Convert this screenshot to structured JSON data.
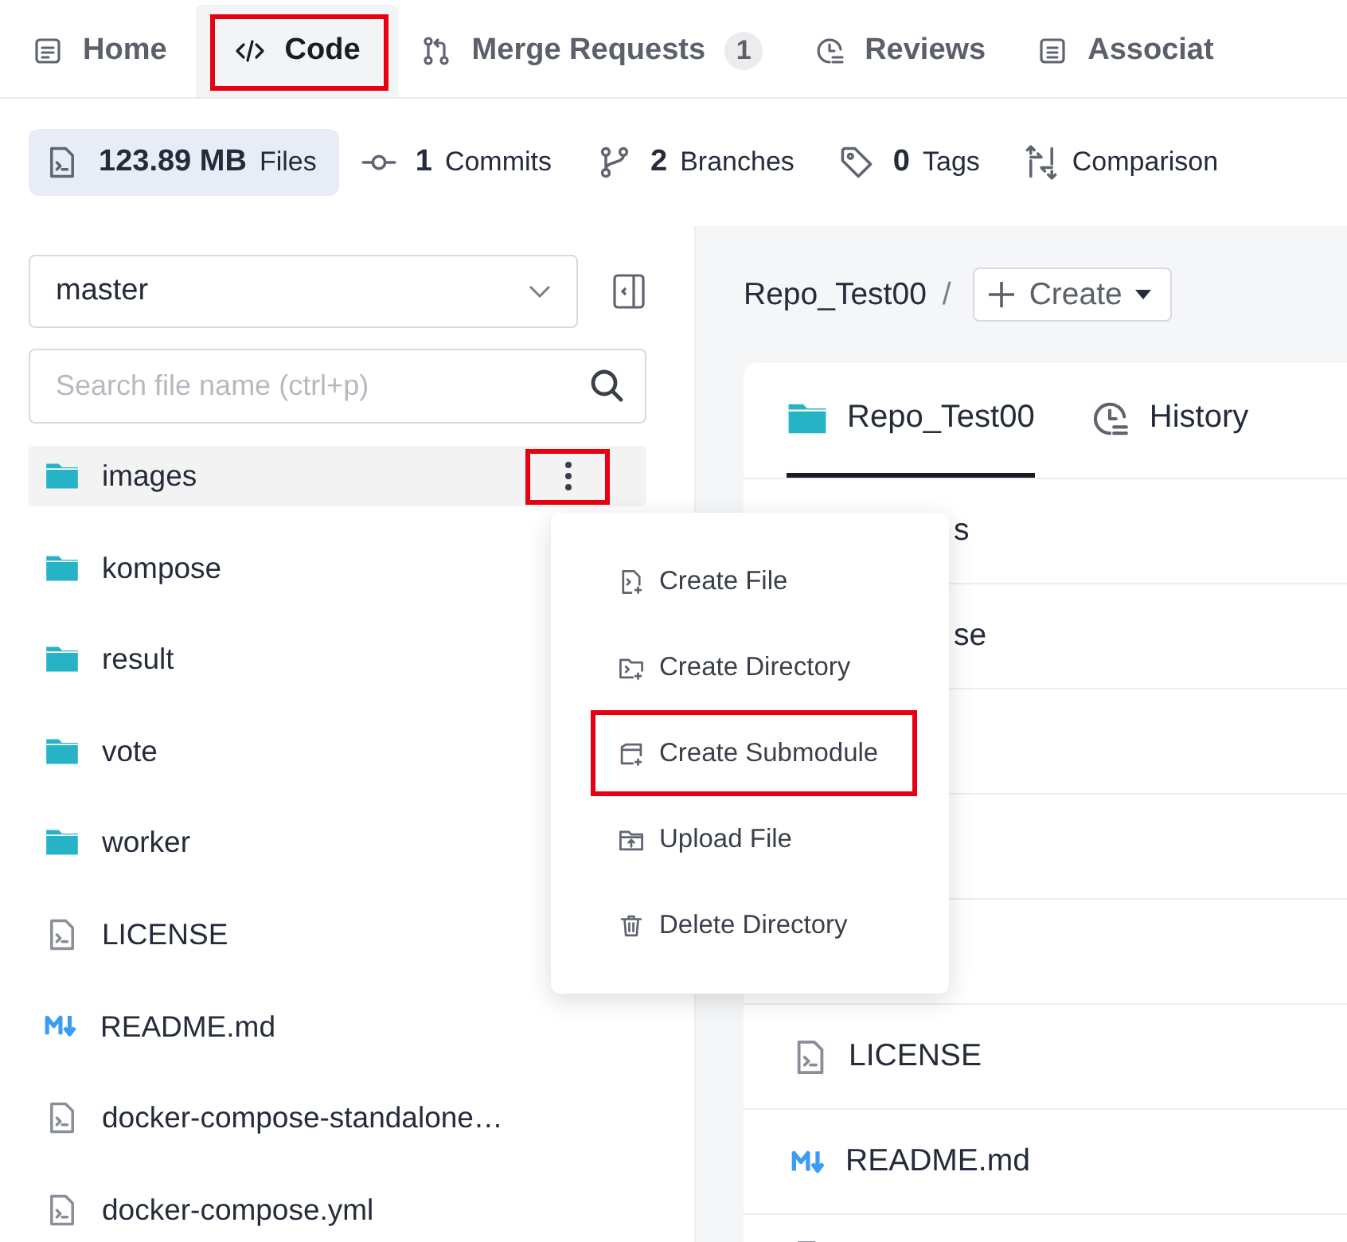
{
  "tabs": [
    {
      "label": "Home",
      "selected": false,
      "highlighted": false
    },
    {
      "label": "Code",
      "selected": true,
      "highlighted": true
    },
    {
      "label": "Merge Requests",
      "badge": "1",
      "selected": false,
      "highlighted": false
    },
    {
      "label": "Reviews",
      "selected": false,
      "highlighted": false
    },
    {
      "label": "Associat",
      "selected": false,
      "highlighted": false
    }
  ],
  "stats": [
    {
      "value": "123.89 MB",
      "label": "Files",
      "selected": true
    },
    {
      "value": "1",
      "label": "Commits",
      "selected": false
    },
    {
      "value": "2",
      "label": "Branches",
      "selected": false
    },
    {
      "value": "0",
      "label": "Tags",
      "selected": false
    },
    {
      "label": "Comparison",
      "selected": false
    }
  ],
  "sidebar": {
    "branch": "master",
    "search": {
      "placeholder": "Search file name (ctrl+p)"
    },
    "items": [
      {
        "name": "images",
        "kind": "folder",
        "hovered": true,
        "menu_button": {
          "highlighted": true
        }
      },
      {
        "name": "kompose",
        "kind": "folder",
        "hovered": false
      },
      {
        "name": "result",
        "kind": "folder",
        "hovered": false
      },
      {
        "name": "vote",
        "kind": "folder",
        "hovered": false
      },
      {
        "name": "worker",
        "kind": "folder",
        "hovered": false
      },
      {
        "name": "LICENSE",
        "kind": "file",
        "hovered": false
      },
      {
        "name": "README.md",
        "kind": "markdown",
        "hovered": false
      },
      {
        "name": "docker-compose-standalone…",
        "kind": "file",
        "hovered": false
      },
      {
        "name": "docker-compose.yml",
        "kind": "file",
        "hovered": false
      }
    ]
  },
  "repo": {
    "breadcrumb": "Repo_Test00",
    "separator": "/",
    "create_button": "Create",
    "tabs": [
      {
        "label": "Repo_Test00",
        "selected": true
      },
      {
        "label": "History",
        "selected": false
      }
    ],
    "rows": [
      {
        "name": "s",
        "kind": "covered"
      },
      {
        "name": "se",
        "kind": "covered"
      },
      {
        "kind": "covered"
      },
      {
        "kind": "covered"
      },
      {
        "kind": "covered"
      },
      {
        "name": "LICENSE",
        "kind": "file"
      },
      {
        "name": "README.md",
        "kind": "markdown"
      },
      {
        "kind": "file"
      }
    ]
  },
  "context_menu": {
    "items": [
      {
        "label": "Create File",
        "highlighted": false
      },
      {
        "label": "Create Directory",
        "highlighted": false
      },
      {
        "label": "Create Submodule",
        "highlighted": true
      },
      {
        "label": "Upload File",
        "highlighted": false
      },
      {
        "label": "Delete Directory",
        "highlighted": false
      }
    ]
  }
}
